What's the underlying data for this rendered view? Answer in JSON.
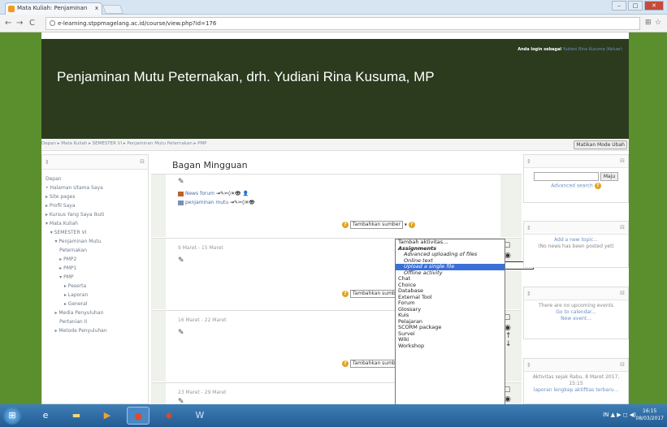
{
  "browser": {
    "tab_title": "Mata Kuliah: Penjaminan",
    "tab_close": "x",
    "url": "e-learning.stppmagelang.ac.id/course/view.php?id=176",
    "win_minimize": "–",
    "win_maximize": "□",
    "win_close": "✕"
  },
  "header": {
    "title": "Penjaminan Mutu Peternakan, drh. Yudiani Rina Kusuma, MP",
    "login_prefix": "Anda login sebagai",
    "login_user": "Yudiani Rina Kusuma (Keluar)"
  },
  "breadcrumb": "Depan ▸ Mata Kuliah ▸ SEMESTER VI ▸ Penjaminan Mutu Peternakan ▸ PMP",
  "edit_button": "Matikan Mode Ubah",
  "left_nav": {
    "items": [
      "Depan",
      "• Halaman Utama Saya",
      "▸ Site pages",
      "▸ Profil Saya",
      "▸ Kursus Yang Saya Ikuti",
      "▾ Mata Kuliah",
      "   ▾ SEMESTER VI",
      "      ▾ Penjaminan Mutu",
      "         Peternakan",
      "         ▸ PMP2",
      "         ▸ PMP1",
      "         ▾ PMP",
      "            ▸ Peserta",
      "            ▸ Laporan",
      "            ▸ General",
      "      ▸ Media Penyuluhan",
      "         Pertanian II",
      "      ▸ Metode Penyuluhan"
    ]
  },
  "main": {
    "heading": "Bagan Mingguan",
    "activities": [
      {
        "name": "News forum",
        "edit_icons": "→✎✂◊✕👁 👤"
      },
      {
        "name": "penjaminan mutu",
        "edit_icons": "→✎✂◊✕👁"
      }
    ],
    "weeks": [
      "9 Maret - 15 Maret",
      "16 Maret - 22 Maret",
      "23 Maret - 29 Maret"
    ],
    "add_resource": "Tambahkan sumber",
    "add_activity": "Tambah aktivitas..."
  },
  "dropdown": {
    "options": [
      {
        "label": "Tambah aktivitas...",
        "kind": "plain"
      },
      {
        "label": "Assignments",
        "kind": "group"
      },
      {
        "label": "Advanced uploading of files",
        "kind": "sub"
      },
      {
        "label": "Online text",
        "kind": "sub"
      },
      {
        "label": "Upload a single file",
        "kind": "selected"
      },
      {
        "label": "Offline activity",
        "kind": "sub"
      },
      {
        "label": "Chat",
        "kind": "plain"
      },
      {
        "label": "Choice",
        "kind": "plain"
      },
      {
        "label": "Database",
        "kind": "plain"
      },
      {
        "label": "External Tool",
        "kind": "plain"
      },
      {
        "label": "Forum",
        "kind": "plain"
      },
      {
        "label": "Glossary",
        "kind": "plain"
      },
      {
        "label": "Kuis",
        "kind": "plain"
      },
      {
        "label": "Pelajaran",
        "kind": "plain"
      },
      {
        "label": "SCORM package",
        "kind": "plain"
      },
      {
        "label": "Survei",
        "kind": "plain"
      },
      {
        "label": "Wiki",
        "kind": "plain"
      },
      {
        "label": "Workshop",
        "kind": "plain"
      }
    ]
  },
  "right_blocks": {
    "search_button": "Maju",
    "search_link": "Advanced search",
    "news_add": "Add a new topic...",
    "news_empty": "(No news has been posted yet)",
    "events_empty": "There are no upcoming events",
    "events_link1": "Go to calendar...",
    "events_link2": "New event...",
    "recent_text": "Aktivitas sejak Rabu, 8 Maret 2017, 15:15",
    "recent_link": "laporan lengkap aktifitas terbaru..."
  },
  "taskbar": {
    "tray": "IN ▲ ▶ ◻ ◀)",
    "time": "16:15",
    "date": "08/03/2017"
  },
  "colors": {
    "page_bg": "#5b8f2e",
    "header_bg": "#2c3b1e",
    "highlight": "#3a6fd6",
    "taskbar": "#2a6aa3"
  }
}
